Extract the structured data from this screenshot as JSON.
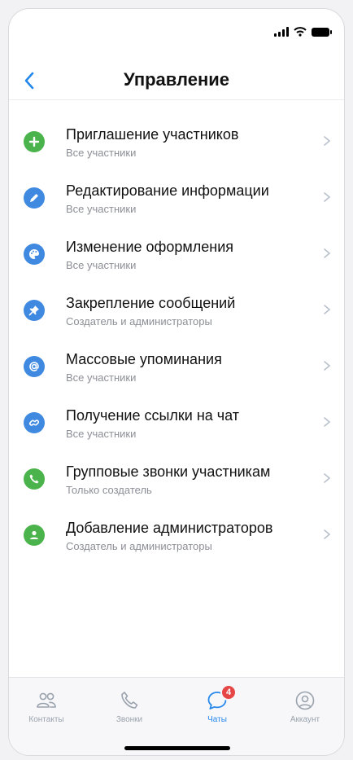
{
  "header": {
    "title": "Управление"
  },
  "items": [
    {
      "title": "Приглашение участников",
      "subtitle": "Все участники",
      "icon": "plus-icon",
      "color": "#4bb34b"
    },
    {
      "title": "Редактирование информации",
      "subtitle": "Все участники",
      "icon": "pencil-icon",
      "color": "#3f8ae0"
    },
    {
      "title": "Изменение оформления",
      "subtitle": "Все участники",
      "icon": "palette-icon",
      "color": "#3f8ae0"
    },
    {
      "title": "Закрепление сообщений",
      "subtitle": "Создатель и администраторы",
      "icon": "pin-icon",
      "color": "#3f8ae0"
    },
    {
      "title": "Массовые упоминания",
      "subtitle": "Все участники",
      "icon": "at-sign-icon",
      "color": "#3f8ae0"
    },
    {
      "title": "Получение ссылки на чат",
      "subtitle": "Все участники",
      "icon": "link-icon",
      "color": "#3f8ae0"
    },
    {
      "title": "Групповые звонки участникам",
      "subtitle": "Только создатель",
      "icon": "phone-icon",
      "color": "#4bb34b"
    },
    {
      "title": "Добавление администраторов",
      "subtitle": "Создатель и администраторы",
      "icon": "user-icon",
      "color": "#4bb34b"
    }
  ],
  "tabbar": {
    "tabs": [
      {
        "label": "Контакты",
        "icon": "contacts-icon"
      },
      {
        "label": "Звонки",
        "icon": "phone-icon"
      },
      {
        "label": "Чаты",
        "icon": "chat-icon",
        "active": true,
        "badge": "4"
      },
      {
        "label": "Аккаунт",
        "icon": "account-icon"
      }
    ]
  },
  "colors": {
    "accent": "#2688eb",
    "green": "#4bb34b",
    "blue": "#3f8ae0",
    "badge": "#e64646"
  }
}
